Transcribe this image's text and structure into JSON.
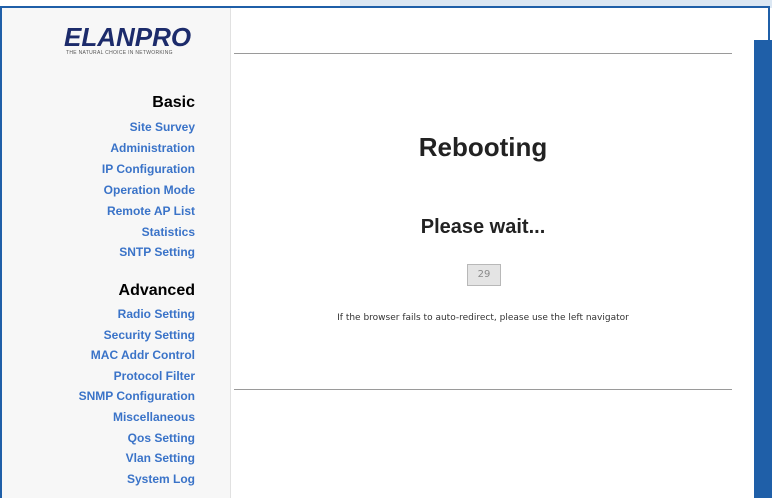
{
  "logo": {
    "text": "ELANPRO",
    "tagline": "THE NATURAL CHOICE IN NETWORKING"
  },
  "sidebar": {
    "basic_title": "Basic",
    "basic_items": [
      "Site Survey",
      "Administration",
      "IP Configuration",
      "Operation Mode",
      "Remote AP List",
      "Statistics",
      "SNTP Setting"
    ],
    "advanced_title": "Advanced",
    "advanced_items": [
      "Radio Setting",
      "Security Setting",
      "MAC Addr Control",
      "Protocol Filter",
      "SNMP Configuration",
      "Miscellaneous",
      "Qos Setting",
      "Vlan Setting",
      "System Log"
    ]
  },
  "main": {
    "title": "Rebooting",
    "subtitle": "Please wait...",
    "countdown": "29",
    "note": "If the browser fails to auto-redirect, please use the left navigator"
  },
  "colors": {
    "frame": "#1f5fa8",
    "link": "#3a73c8",
    "logo": "#1c2b6b"
  }
}
